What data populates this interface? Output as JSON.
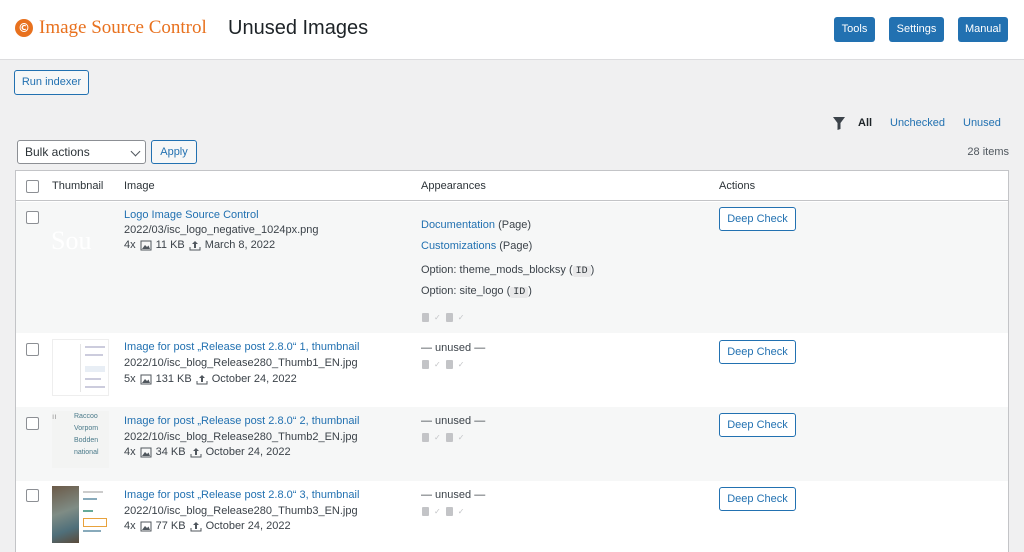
{
  "header": {
    "logo_glyph": "©",
    "brand": "Image Source Control",
    "title": "Unused Images",
    "buttons": {
      "tools": "Tools",
      "settings": "Settings",
      "manual": "Manual"
    },
    "accent": "#e8711e",
    "primary": "#2271b1"
  },
  "toolbar": {
    "run_indexer": "Run indexer",
    "filters": {
      "all": "All",
      "unchecked": "Unchecked",
      "unused": "Unused"
    },
    "bulk_actions": "Bulk actions",
    "apply": "Apply",
    "items_count": "28 items"
  },
  "table": {
    "columns": {
      "thumbnail": "Thumbnail",
      "image": "Image",
      "appearances": "Appearances",
      "actions": "Actions"
    },
    "rows": [
      {
        "title": "Logo Image Source Control",
        "path": "2022/03/isc_logo_negative_1024px.png",
        "count": "4x",
        "size": "11 KB",
        "date": "March 8, 2022",
        "thumb_text": "Sou",
        "appearances": [
          {
            "link": "Documentation",
            "type": "(Page)"
          },
          {
            "link": "Customizations",
            "type": "(Page)"
          }
        ],
        "options": [
          {
            "label": "Option: theme_mods_blocksy (",
            "code": "ID",
            "end": ")"
          },
          {
            "label": "Option: site_logo (",
            "code": "ID",
            "end": ")"
          }
        ],
        "action": "Deep Check"
      },
      {
        "title": "Image for post „Release post 2.8.0“ 1, thumbnail",
        "path": "2022/10/isc_blog_Release280_Thumb1_EN.jpg",
        "count": "5x",
        "size": "131 KB",
        "date": "October 24, 2022",
        "status": "— unused —",
        "action": "Deep Check"
      },
      {
        "title": "Image for post „Release post 2.8.0“ 2, thumbnail",
        "path": "2022/10/isc_blog_Release280_Thumb2_EN.jpg",
        "count": "4x",
        "size": "34 KB",
        "date": "October 24, 2022",
        "status": "— unused —",
        "thumb_lines": [
          "Raccoo",
          "Vorpom",
          "Bodden",
          "national"
        ],
        "action": "Deep Check"
      },
      {
        "title": "Image for post „Release post 2.8.0“ 3, thumbnail",
        "path": "2022/10/isc_blog_Release280_Thumb3_EN.jpg",
        "count": "4x",
        "size": "77 KB",
        "date": "October 24, 2022",
        "status": "— unused —",
        "action": "Deep Check"
      }
    ]
  }
}
